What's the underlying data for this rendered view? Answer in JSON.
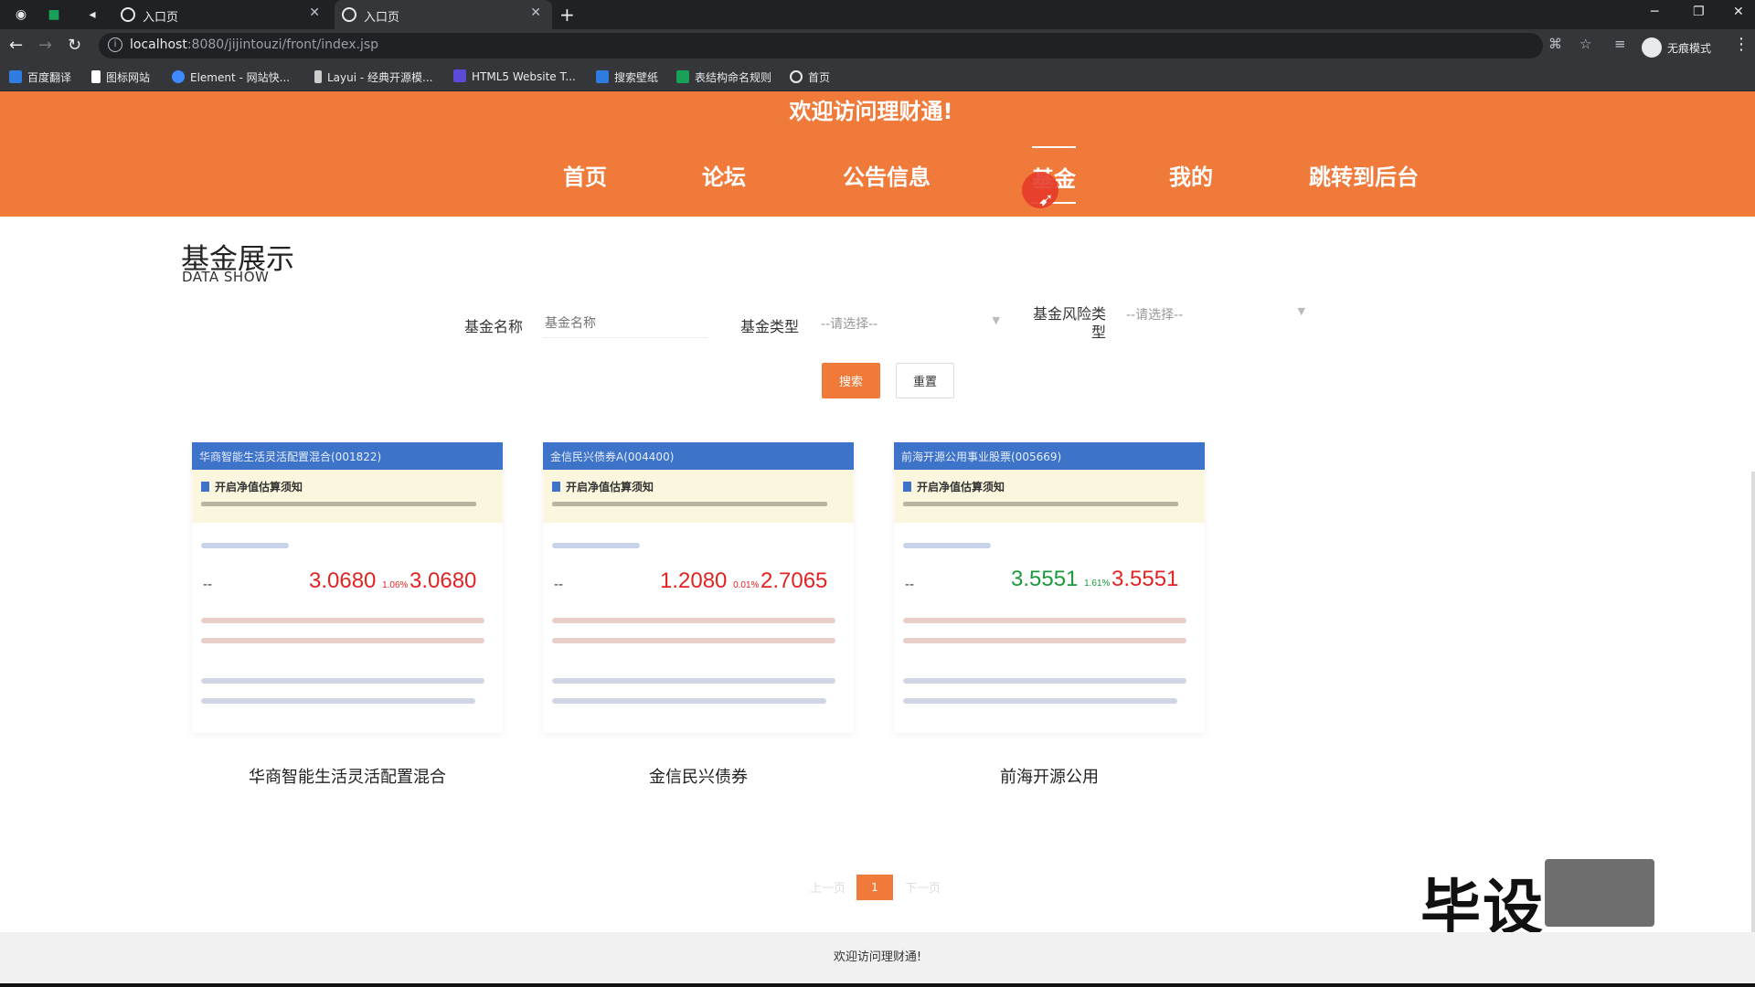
{
  "browser": {
    "tabs": [
      {
        "label": "入口页"
      },
      {
        "label": "入口页"
      }
    ],
    "url": {
      "host": "localhost",
      "path": ":8080/jijintouzi/front/index.jsp"
    },
    "incognito_label": "无痕模式",
    "bookmarks": [
      {
        "label": "百度翻译",
        "color": "#2f7be0"
      },
      {
        "label": "图标网站",
        "color": "#ffffff"
      },
      {
        "label": "Element - 网站快...",
        "color": "#3d8bff"
      },
      {
        "label": "Layui - 经典开源模...",
        "color": "#cccccc"
      },
      {
        "label": "HTML5 Website T...",
        "color": "#5b4bd6"
      },
      {
        "label": "搜索壁纸",
        "color": "#2f7be0"
      },
      {
        "label": "表结构命名规则",
        "color": "#18a058"
      },
      {
        "label": "首页",
        "color": "#ffffff"
      }
    ]
  },
  "site": {
    "welcome": "欢迎访问理财通!",
    "nav": [
      {
        "label": "首页"
      },
      {
        "label": "论坛"
      },
      {
        "label": "公告信息"
      },
      {
        "label": "基金"
      },
      {
        "label": "我的"
      },
      {
        "label": "跳转到后台"
      }
    ],
    "accent_color": "#f07a3a"
  },
  "main": {
    "title": "基金展示",
    "subtitle": "DATA SHOW",
    "filters": {
      "name_label": "基金名称",
      "name_placeholder": "基金名称",
      "type_label": "基金类型",
      "type_value": "--请选择--",
      "risk_label": "基金风险类型",
      "risk_value": "--请选择--"
    },
    "search_button": "搜索",
    "reset_button": "重置",
    "cards": [
      {
        "header": "华商智能生活灵活配置混合(001822)",
        "notice": "开启净值估算须知",
        "nav_value": "3.0680",
        "nav_change": "1.06%",
        "acc_value": "3.0680",
        "nav_color": "#e02424",
        "acc_color": "#e02424",
        "name": "华商智能生活灵活配置混合"
      },
      {
        "header": "金信民兴债券A(004400)",
        "notice": "开启净值估算须知",
        "nav_value": "1.2080",
        "nav_change": "0.01%",
        "acc_value": "2.7065",
        "nav_color": "#e02424",
        "acc_color": "#e02424",
        "name": "金信民兴债券"
      },
      {
        "header": "前海开源公用事业股票(005669)",
        "notice": "开启净值估算须知",
        "nav_value": "3.5551",
        "nav_change": "1.61%",
        "acc_value": "3.5551",
        "nav_color": "#1a9a3a",
        "acc_color": "#e02424",
        "name": "前海开源公用"
      }
    ],
    "pagination": {
      "prev": "上一页",
      "current": "1",
      "next": "下一页"
    }
  },
  "watermark": "毕设",
  "footer": "欢迎访问理财通!"
}
